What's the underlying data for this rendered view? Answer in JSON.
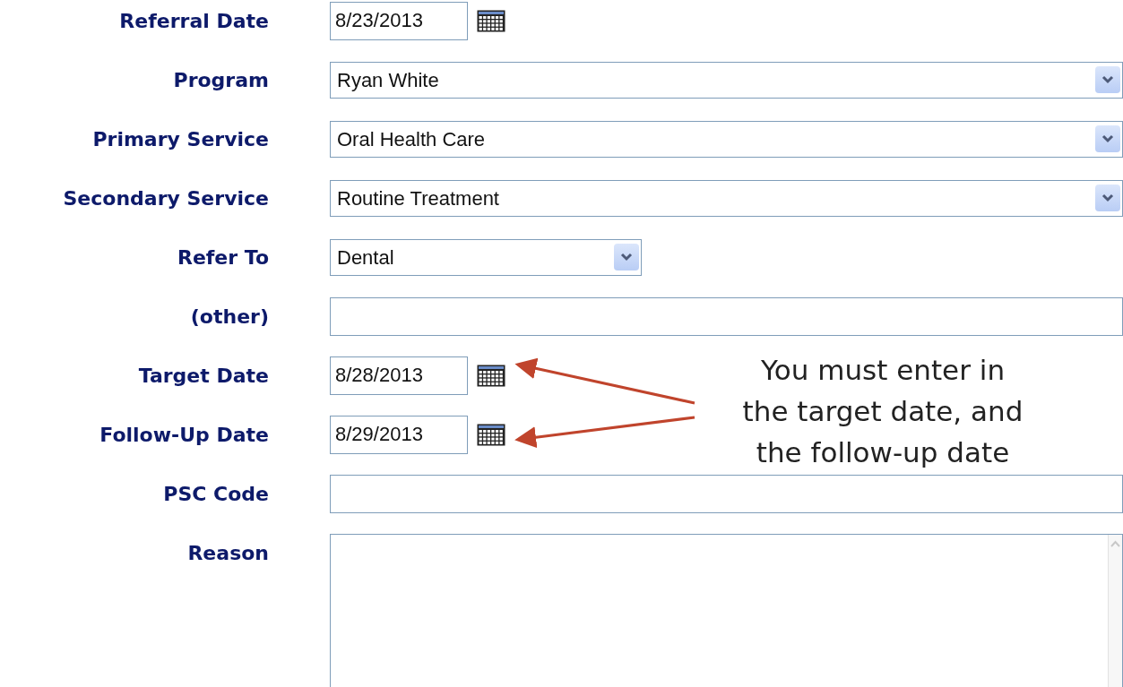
{
  "fields": [
    {
      "label": "Referral Date",
      "kind": "date",
      "value": "8/23/2013"
    },
    {
      "label": "Program",
      "kind": "select",
      "value": "Ryan White"
    },
    {
      "label": "Primary Service",
      "kind": "select",
      "value": "Oral Health Care"
    },
    {
      "label": "Secondary Service",
      "kind": "select",
      "value": "Routine Treatment"
    },
    {
      "label": "Refer To",
      "kind": "short-select",
      "value": "Dental"
    },
    {
      "label": "(other)",
      "kind": "text"
    },
    {
      "label": "Target Date",
      "kind": "date",
      "value": "8/28/2013"
    },
    {
      "label": "Follow-Up Date",
      "kind": "date",
      "value": "8/29/2013"
    },
    {
      "label": "PSC Code",
      "kind": "text"
    },
    {
      "label": "Reason",
      "kind": "textarea"
    }
  ],
  "annotation": {
    "lines": [
      "You must enter in",
      "the target date, and",
      "the follow-up date"
    ]
  }
}
